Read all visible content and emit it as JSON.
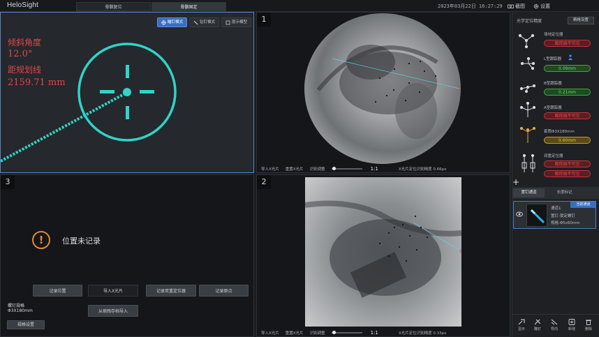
{
  "app": {
    "logo": "HeloSight"
  },
  "topbar": {
    "tabs": [
      {
        "label": "骨骼复位",
        "active": false
      },
      {
        "label": "骨骼固定",
        "active": true
      }
    ],
    "datetime": "2023年03月22日 16:27:29",
    "screenshot_label": "截图",
    "settings_label": "设置"
  },
  "panel4": {
    "modes": [
      {
        "label": "瞄钉模式",
        "active": true
      },
      {
        "label": "钻钉模式",
        "active": false
      },
      {
        "label": "层示模型",
        "active": false
      }
    ],
    "angle_label": "倾斜角度",
    "angle_value": "12.0°",
    "distance_label": "距规划线",
    "distance_value": "2159.71 mm",
    "target_color": "#2fd4c8"
  },
  "panel1": {
    "number": "1",
    "toolbar": {
      "import": "导入X光片",
      "reset": "重置X光片",
      "recognize": "识别调整",
      "ratio": "1:1",
      "accuracy": "X光片定位识别精度 0.66px"
    }
  },
  "panel2": {
    "number": "2",
    "toolbar": {
      "import": "导入X光片",
      "reset": "重置X光片",
      "recognize": "识别调整",
      "ratio": "1:1",
      "accuracy": "X光片定位识别精度 0.33px"
    }
  },
  "panel3": {
    "number": "3",
    "warning": "位置未记录",
    "buttons": {
      "record_position": "记录位置",
      "import_xray": "导入X光片",
      "record_dual": "记录双重定位器",
      "record_point": "记录原点",
      "import_from_history": "从病残存档导入",
      "screw_settings": "规格设置"
    },
    "screw_spec_label": "螺钉规格",
    "screw_spec_value": "Φ3X180mm"
  },
  "right": {
    "title": "光学定位精度",
    "settings_button": "精格设置",
    "trackers": [
      {
        "name": "场地定位器",
        "status": "跟踪器不可见",
        "state": "red"
      },
      {
        "name": "L型跟踪器",
        "status": "0.09mm",
        "state": "green"
      },
      {
        "name": "B型跟踪器",
        "status": "0.21mm",
        "state": "green"
      },
      {
        "name": "A型跟踪器",
        "status": "跟踪器不可见",
        "state": "red"
      },
      {
        "name": "套筒Φ3X180mm",
        "status": "0.60mm",
        "state": "yellow"
      },
      {
        "name": "双重定位器",
        "status": "跟踪器不可见",
        "status2": "跟踪器不可见",
        "state": "red"
      }
    ],
    "tabs": [
      {
        "label": "置钉通道",
        "active": true
      },
      {
        "label": "长度标记",
        "active": false
      }
    ],
    "channel": {
      "badge": "当前通道",
      "name": "通道1",
      "screw_type": "置钉:锁定螺钉",
      "spec": "规格:Φ5x60mm"
    },
    "tools": [
      "显示",
      "瞄钉",
      "导向",
      "新增",
      "删除"
    ]
  }
}
